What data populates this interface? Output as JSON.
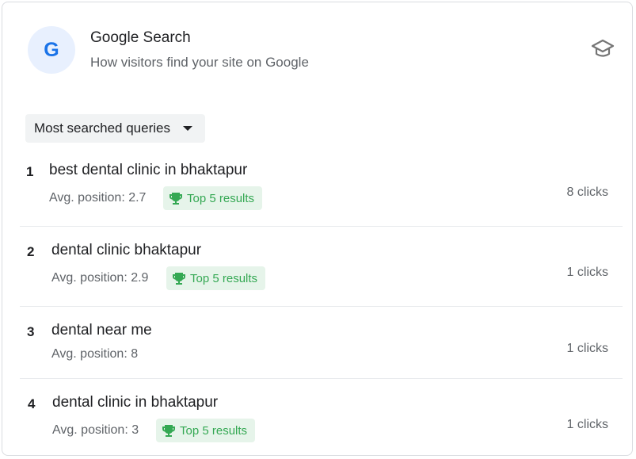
{
  "header": {
    "logo_letter": "G",
    "title": "Google Search",
    "subtitle": "How visitors find your site on Google",
    "learn_icon": "graduation-cap-icon"
  },
  "filter": {
    "selected": "Most searched queries",
    "icon": "chevron-down-icon"
  },
  "queries": [
    {
      "rank": "1",
      "query": "best dental clinic in bhaktapur",
      "avg_position": "Avg. position: 2.7",
      "badge": "Top 5 results",
      "clicks": "8 clicks"
    },
    {
      "rank": "2",
      "query": "dental clinic bhaktapur",
      "avg_position": "Avg. position: 2.9",
      "badge": "Top 5 results",
      "clicks": "1 clicks"
    },
    {
      "rank": "3",
      "query": "dental near me",
      "avg_position": "Avg. position: 8",
      "badge": null,
      "clicks": "1 clicks"
    },
    {
      "rank": "4",
      "query": "dental clinic in bhaktapur",
      "avg_position": "Avg. position: 3",
      "badge": "Top 5 results",
      "clicks": "1 clicks"
    }
  ],
  "colors": {
    "accent": "#1a73e8",
    "badge_bg": "#e6f4ea",
    "badge_text": "#34a853",
    "secondary_text": "#5f6368"
  }
}
